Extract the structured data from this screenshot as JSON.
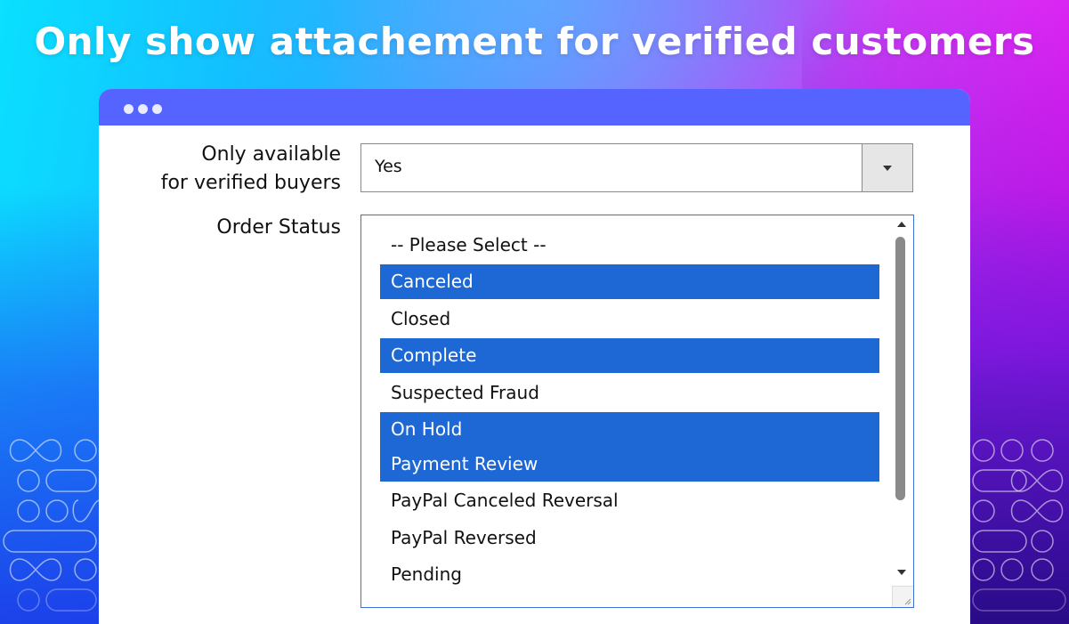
{
  "headline": "Only show attachement for verified customers",
  "window": {
    "titlebar_icon": "three-dots-icon"
  },
  "form": {
    "verified_label_line1": "Only available",
    "verified_label_line2": "for verified buyers",
    "verified_select": {
      "value": "Yes",
      "icon": "chevron-down-icon"
    },
    "order_status_label": "Order Status",
    "order_status_options": [
      {
        "label": "-- Please Select --",
        "selected": false
      },
      {
        "label": "Canceled",
        "selected": true
      },
      {
        "label": "Closed",
        "selected": false
      },
      {
        "label": "Complete",
        "selected": true
      },
      {
        "label": "Suspected Fraud",
        "selected": false
      },
      {
        "label": "On Hold",
        "selected": true
      },
      {
        "label": "Payment Review",
        "selected": true
      },
      {
        "label": "PayPal Canceled Reversal",
        "selected": false
      },
      {
        "label": "PayPal Reversed",
        "selected": false
      },
      {
        "label": "Pending",
        "selected": false
      }
    ]
  },
  "colors": {
    "titlebar": "#5563ff",
    "selected_option": "#1e68d6",
    "listbox_border": "#3b6fd4"
  }
}
